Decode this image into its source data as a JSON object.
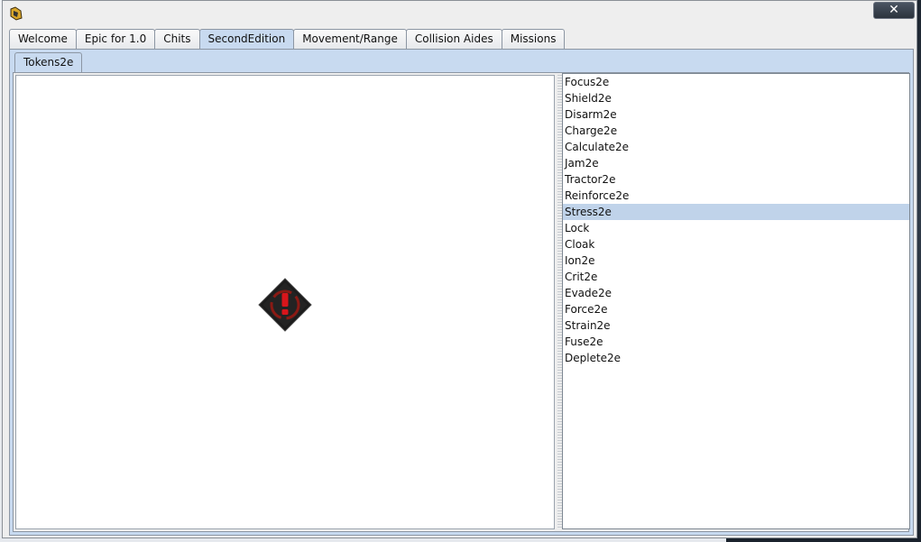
{
  "window": {
    "close_glyph": "✕"
  },
  "tabs": [
    {
      "label": "Welcome",
      "active": false
    },
    {
      "label": "Epic for 1.0",
      "active": false
    },
    {
      "label": "Chits",
      "active": false
    },
    {
      "label": "SecondEdition",
      "active": true
    },
    {
      "label": "Movement/Range",
      "active": false
    },
    {
      "label": "Collision Aides",
      "active": false
    },
    {
      "label": "Missions",
      "active": false
    }
  ],
  "subtab": {
    "label": "Tokens2e"
  },
  "tokens": [
    "Focus2e",
    "Shield2e",
    "Disarm2e",
    "Charge2e",
    "Calculate2e",
    "Jam2e",
    "Tractor2e",
    "Reinforce2e",
    "Stress2e",
    "Lock",
    "Cloak",
    "Ion2e",
    "Crit2e",
    "Evade2e",
    "Force2e",
    "Strain2e",
    "Fuse2e",
    "Deplete2e"
  ],
  "selected_token": "Stress2e",
  "preview": {
    "icon": "stress-token-icon",
    "accent": "#c0151a",
    "fill": "#1b1b1b"
  },
  "colors": {
    "tab_active": "#c8daf0",
    "selection": "#c0d3ea"
  }
}
